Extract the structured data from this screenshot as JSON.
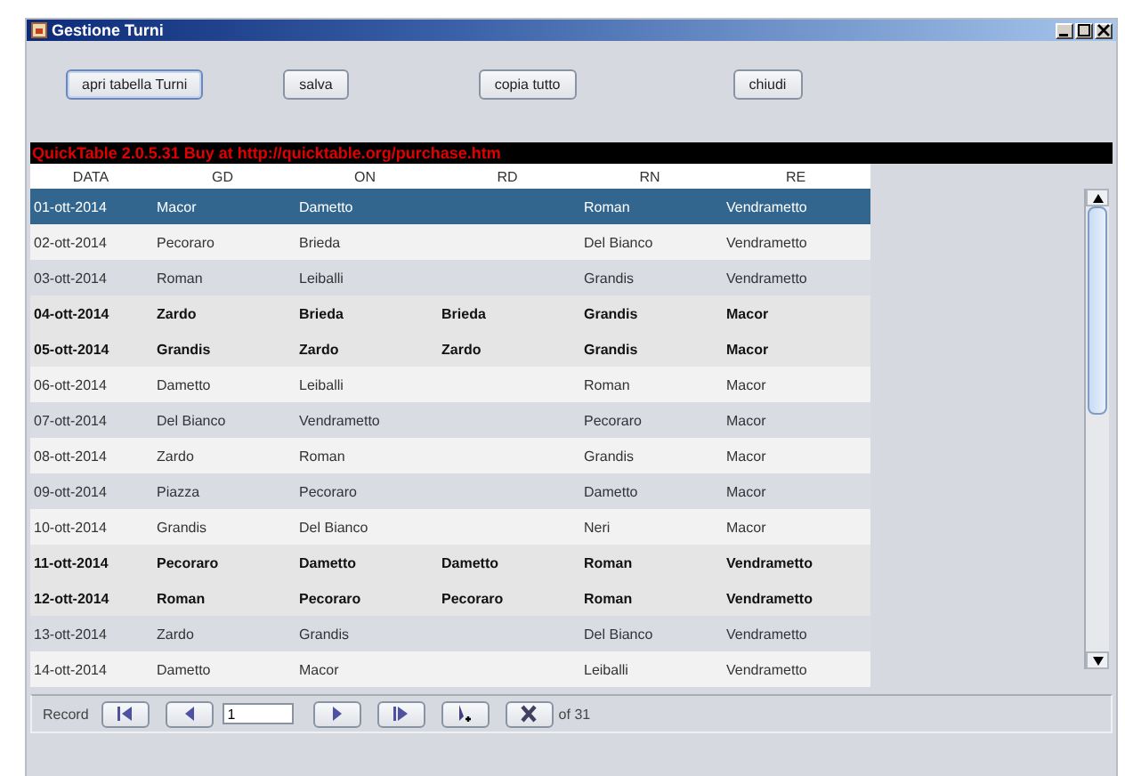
{
  "window": {
    "title": "Gestione Turni"
  },
  "buttons": [
    {
      "label": "apri tabella Turni",
      "focused": true
    },
    {
      "label": "salva",
      "focused": false
    },
    {
      "label": "copia tutto",
      "focused": false
    },
    {
      "label": "chiudi",
      "focused": false
    }
  ],
  "banner": "QuickTable 2.0.5.31 Buy at http://quicktable.org/purchase.htm",
  "table": {
    "columns": [
      "DATA",
      "GD",
      "ON",
      "RD",
      "RN",
      "RE"
    ],
    "rows": [
      {
        "selected": true,
        "holiday": false,
        "cells": [
          "01-ott-2014",
          "Macor",
          "Dametto",
          null,
          "Roman",
          "Vendrametto"
        ]
      },
      {
        "selected": false,
        "holiday": false,
        "cells": [
          "02-ott-2014",
          "Pecoraro",
          "Brieda",
          null,
          "Del Bianco",
          "Vendrametto"
        ]
      },
      {
        "selected": false,
        "holiday": false,
        "cells": [
          "03-ott-2014",
          "Roman",
          "Leiballi",
          null,
          "Grandis",
          "Vendrametto"
        ]
      },
      {
        "selected": false,
        "holiday": true,
        "cells": [
          "04-ott-2014",
          "Zardo",
          "Brieda",
          "Brieda",
          "Grandis",
          "Macor"
        ]
      },
      {
        "selected": false,
        "holiday": true,
        "cells": [
          "05-ott-2014",
          "Grandis",
          "Zardo",
          "Zardo",
          "Grandis",
          "Macor"
        ]
      },
      {
        "selected": false,
        "holiday": false,
        "cells": [
          "06-ott-2014",
          "Dametto",
          "Leiballi",
          null,
          "Roman",
          "Macor"
        ]
      },
      {
        "selected": false,
        "holiday": false,
        "cells": [
          "07-ott-2014",
          "Del Bianco",
          "Vendrametto",
          null,
          "Pecoraro",
          "Macor"
        ]
      },
      {
        "selected": false,
        "holiday": false,
        "cells": [
          "08-ott-2014",
          "Zardo",
          "Roman",
          null,
          "Grandis",
          "Macor"
        ]
      },
      {
        "selected": false,
        "holiday": false,
        "cells": [
          "09-ott-2014",
          "Piazza",
          "Pecoraro",
          null,
          "Dametto",
          "Macor"
        ]
      },
      {
        "selected": false,
        "holiday": false,
        "cells": [
          "10-ott-2014",
          "Grandis",
          "Del Bianco",
          null,
          "Neri",
          "Macor"
        ]
      },
      {
        "selected": false,
        "holiday": true,
        "cells": [
          "11-ott-2014",
          "Pecoraro",
          "Dametto",
          "Dametto",
          "Roman",
          "Vendrametto"
        ]
      },
      {
        "selected": false,
        "holiday": true,
        "cells": [
          "12-ott-2014",
          "Roman",
          "Pecoraro",
          "Pecoraro",
          "Roman",
          "Vendrametto"
        ]
      },
      {
        "selected": false,
        "holiday": false,
        "cells": [
          "13-ott-2014",
          "Zardo",
          "Grandis",
          null,
          "Del Bianco",
          "Vendrametto"
        ]
      },
      {
        "selected": false,
        "holiday": false,
        "cells": [
          "14-ott-2014",
          "Dametto",
          "Macor",
          null,
          "Leiballi",
          "Vendrametto"
        ]
      }
    ]
  },
  "navigator": {
    "label": "Record",
    "record": "1",
    "total": "of 31",
    "controls": [
      {
        "kind": "first"
      },
      {
        "kind": "prev"
      },
      {
        "kind": "field"
      },
      {
        "kind": "next"
      },
      {
        "kind": "last"
      },
      {
        "kind": "new"
      },
      {
        "kind": "delete"
      }
    ]
  }
}
